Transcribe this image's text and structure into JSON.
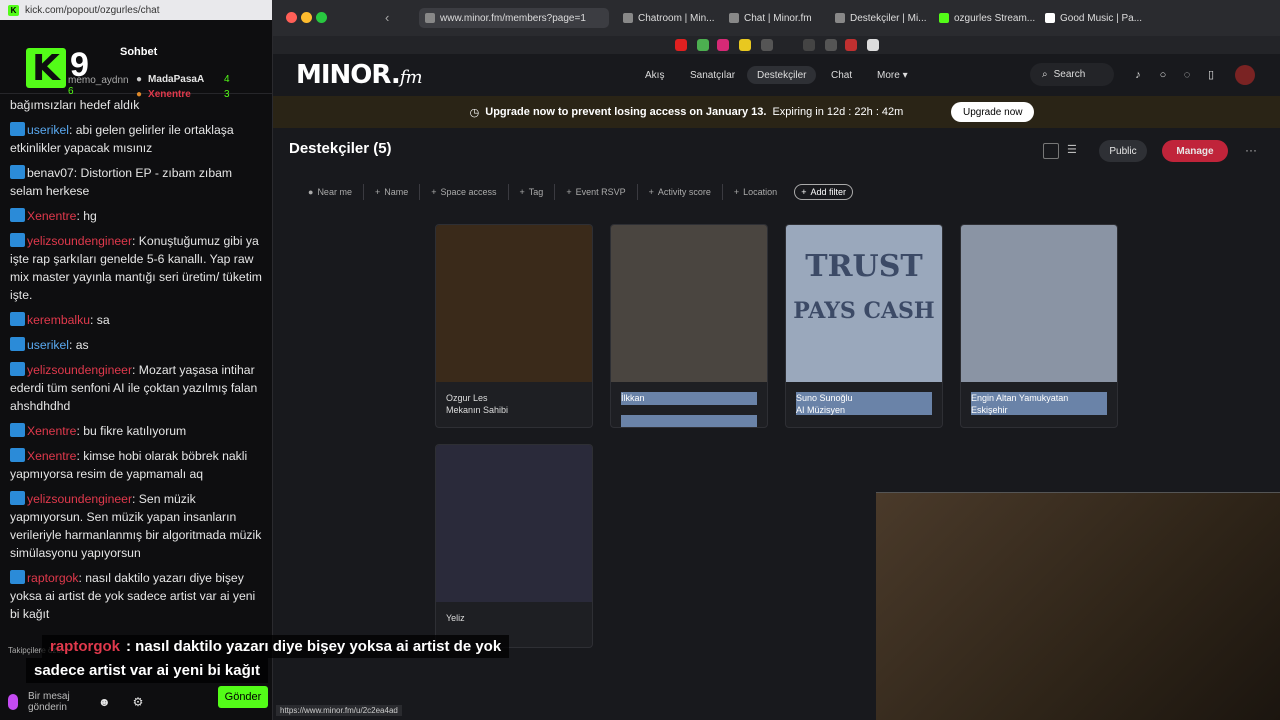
{
  "chat": {
    "url": "kick.com/popout/ozgurles/chat",
    "title": "Sohbet",
    "brand_number": "9",
    "leaderboard": [
      {
        "name": "MadaPasaA",
        "count": "4"
      },
      {
        "name": "Xenentre",
        "count": "3"
      }
    ],
    "behind_user": "memo_aydnn",
    "behind_count": "6",
    "messages": [
      {
        "user": "",
        "user_color": "#e6e6e6",
        "text": "bağımsızları hedef aldık"
      },
      {
        "user": "userikel",
        "user_color": "#5aa9f0",
        "text": ": abi gelen gelirler ile ortaklaşa etkinlikler yapacak mısınız"
      },
      {
        "user": "benav07",
        "user_color": "#e6e6e6",
        "text": ": Distortion EP - zıbam zıbam selam herkese"
      },
      {
        "user": "Xenentre",
        "user_color": "#e0394c",
        "text": ": hg"
      },
      {
        "user": "yelizsoundengineer",
        "user_color": "#e0394c",
        "text": ": Konuştuğumuz gibi ya işte rap şarkıları genelde 5-6 kanallı. Yap raw mix master yayınla mantığı seri üretim/ tüketim işte."
      },
      {
        "user": "kerembalku",
        "user_color": "#e0394c",
        "text": ": sa"
      },
      {
        "user": "userikel",
        "user_color": "#5aa9f0",
        "text": ": as"
      },
      {
        "user": "yelizsoundengineer",
        "user_color": "#e0394c",
        "text": ": Mozart yaşasa intihar ederdi tüm senfoni AI ile çoktan yazılmış falan ahshdhdhd"
      },
      {
        "user": "Xenentre",
        "user_color": "#e0394c",
        "text": ": bu fikre katılıyorum"
      },
      {
        "user": "Xenentre",
        "user_color": "#e0394c",
        "text": ": kimse hobi olarak böbrek nakli yapmıyorsa resim de yapmamalı aq"
      },
      {
        "user": "yelizsoundengineer",
        "user_color": "#e0394c",
        "text": ": Sen müzik yapmıyorsun. Sen müzik yapan insanların verileriyle harmanlanmış bir algoritmada müzik simülasyonu yapıyorsun"
      },
      {
        "user": "raptorgok",
        "user_color": "#e0394c",
        "text": ": nasıl daktilo yazarı diye bişey yoksa ai artist de yok sadece artist var ai yeni bi kağıt"
      }
    ],
    "followers_label": "Takipçilere özel",
    "input_placeholder": "Bir mesaj gönderin",
    "send_label": "Gönder"
  },
  "overlay": {
    "user": "raptorgok",
    "line1": ": nasıl daktilo yazarı diye bişey yoksa ai artist de yok",
    "line2": "sadece artist var ai yeni bi kağıt"
  },
  "browser": {
    "url": "www.minor.fm/members?page=1",
    "tabs": [
      "Chatroom | Min...",
      "Chat | Minor.fm",
      "Destekçiler | Mi...",
      "ozgurles Stream...",
      "Good Music | Pa..."
    ],
    "hover_url": "https://www.minor.fm/u/2c2ea4ad"
  },
  "site": {
    "logo": "MINOR.",
    "logo_suffix": "fm",
    "nav": [
      "Akış",
      "Sanatçılar",
      "Destekçiler",
      "Chat",
      "More"
    ],
    "search": "Search",
    "banner_main": "Upgrade now to prevent losing access on January 13.",
    "banner_expiry": "Expiring in 12d : 22h : 42m",
    "upgrade_label": "Upgrade now",
    "page_title": "Destekçiler (5)",
    "public_label": "Public",
    "manage_label": "Manage",
    "filters": [
      "Near me",
      "Name",
      "Space access",
      "Tag",
      "Event RSVP",
      "Activity score",
      "Location"
    ],
    "add_filter": "Add filter",
    "members": [
      {
        "name": "Ozgur Les",
        "subtitle": "Mekanın Sahibi",
        "color": "#3a2a1a"
      },
      {
        "name": "İlkkan",
        "subtitle": "",
        "color": "#4a4540"
      },
      {
        "name": "Suno Sunoğlu",
        "subtitle": "AI Müzisyen",
        "color": "#9aa8bc",
        "image_text_1": "TRUST",
        "image_text_2": "PAYS CASH"
      },
      {
        "name": "Engin Altan Yamukyatan",
        "subtitle": "Eskişehir",
        "color": "#8a94a4"
      },
      {
        "name": "Yeliz",
        "subtitle": "",
        "color": "#2a2a3a"
      }
    ]
  }
}
